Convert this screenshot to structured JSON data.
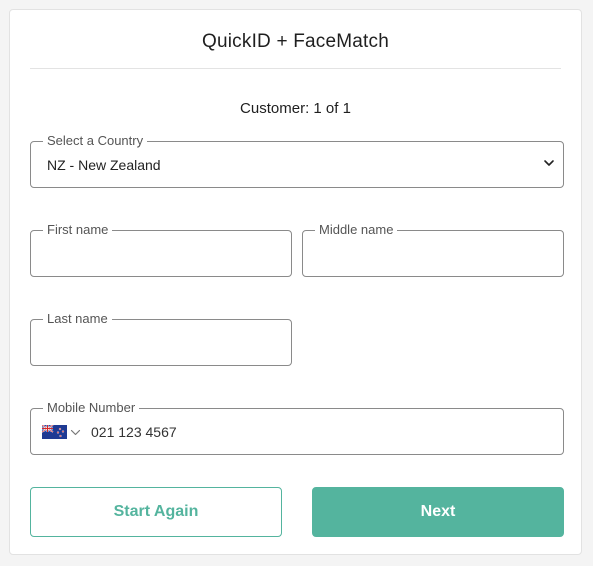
{
  "header": {
    "title": "QuickID + FaceMatch"
  },
  "customer_counter": "Customer: 1 of 1",
  "form": {
    "country": {
      "label": "Select a Country",
      "value": "NZ - New Zealand"
    },
    "first_name": {
      "label": "First name",
      "value": ""
    },
    "middle_name": {
      "label": "Middle name",
      "value": ""
    },
    "last_name": {
      "label": "Last name",
      "value": ""
    },
    "mobile": {
      "label": "Mobile Number",
      "value": "021 123 4567",
      "flag_icon": "nz-flag-icon"
    }
  },
  "actions": {
    "start_again_label": "Start Again",
    "next_label": "Next"
  },
  "colors": {
    "accent": "#54b49e",
    "border": "#8a8a8a"
  }
}
